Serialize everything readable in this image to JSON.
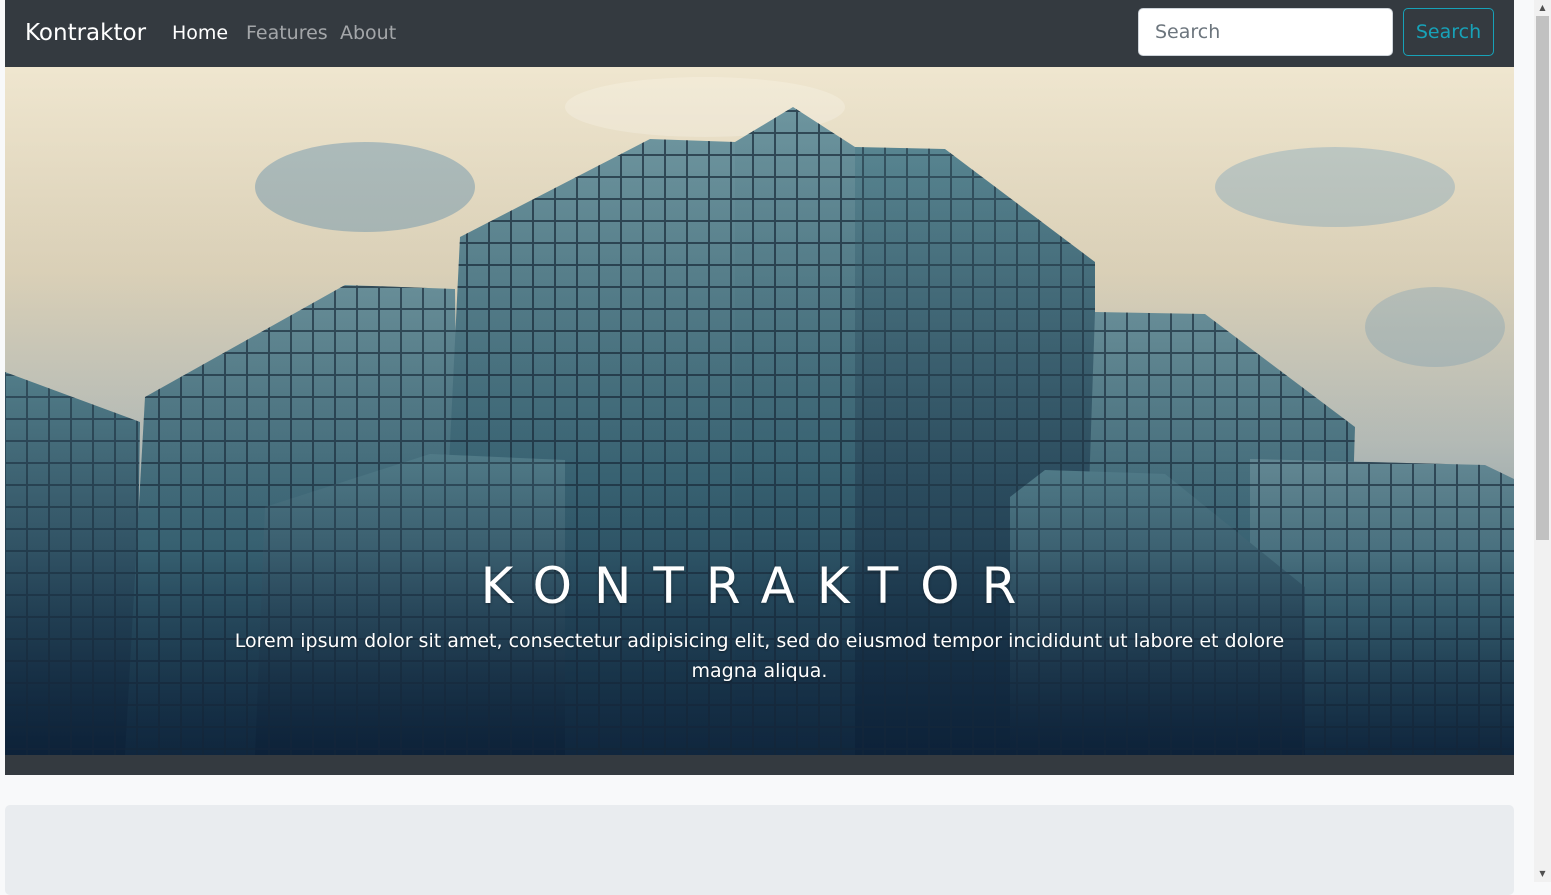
{
  "navbar": {
    "brand": "Kontraktor",
    "links": [
      {
        "label": "Home",
        "active": true
      },
      {
        "label": "Features",
        "active": false
      },
      {
        "label": "About",
        "active": false
      }
    ],
    "search": {
      "placeholder": "Search",
      "button_label": "Search"
    }
  },
  "hero": {
    "title": "KONTRAKTOR",
    "lead": "Lorem ipsum dolor sit amet, consectetur adipisicing elit, sed do eiusmod tempor incididunt ut labore et dolore magna aliqua.",
    "image_description_icon": "building-photo"
  },
  "colors": {
    "navbar_bg": "#343a40",
    "search_button_accent": "#17a2b8",
    "page_bg": "#f8f9fa",
    "jumbotron_bg": "#e9ecef"
  },
  "scrollbar": {
    "up_icon": "arrow-up-icon",
    "down_icon": "arrow-down-icon"
  }
}
